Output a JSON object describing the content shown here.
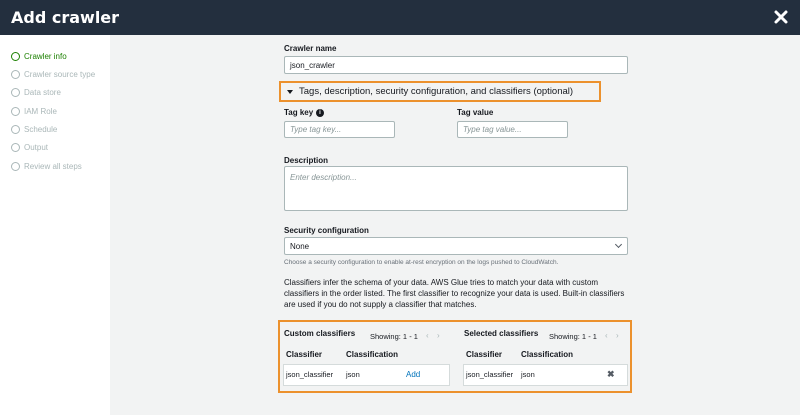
{
  "header": {
    "title": "Add crawler"
  },
  "sidebar": {
    "steps": [
      {
        "label": "Crawler info",
        "active": true
      },
      {
        "label": "Crawler source type",
        "active": false
      },
      {
        "label": "Data store",
        "active": false
      },
      {
        "label": "IAM Role",
        "active": false
      },
      {
        "label": "Schedule",
        "active": false
      },
      {
        "label": "Output",
        "active": false
      },
      {
        "label": "Review all steps",
        "active": false
      }
    ]
  },
  "form": {
    "crawler_name_label": "Crawler name",
    "crawler_name_value": "json_crawler",
    "expander_label": "Tags, description, security configuration, and classifiers (optional)",
    "tag_key_label": "Tag key",
    "tag_key_placeholder": "Type tag key...",
    "tag_value_label": "Tag value",
    "tag_value_placeholder": "Type tag value...",
    "description_label": "Description",
    "description_placeholder": "Enter description...",
    "security_label": "Security configuration",
    "security_value": "None",
    "security_hint": "Choose a security configuration to enable at-rest encryption on the logs pushed to CloudWatch.",
    "classifiers_text": "Classifiers infer the schema of your data. AWS Glue tries to match your data with custom classifiers in the order listed. The first classifier to recognize your data is used. Built-in classifiers are used if you do not supply a classifier that matches."
  },
  "custom_classifiers": {
    "title": "Custom classifiers",
    "showing": "Showing: 1 - 1",
    "columns": [
      "Classifier",
      "Classification"
    ],
    "rows": [
      {
        "classifier": "json_classifier",
        "classification": "json",
        "action": "Add"
      }
    ]
  },
  "selected_classifiers": {
    "title": "Selected classifiers",
    "showing": "Showing: 1 - 1",
    "columns": [
      "Classifier",
      "Classification"
    ],
    "rows": [
      {
        "classifier": "json_classifier",
        "classification": "json"
      }
    ]
  },
  "colors": {
    "header_bg": "#232f3e",
    "active_step": "#1d8102",
    "highlight": "#ec912d",
    "link": "#0073bb"
  }
}
